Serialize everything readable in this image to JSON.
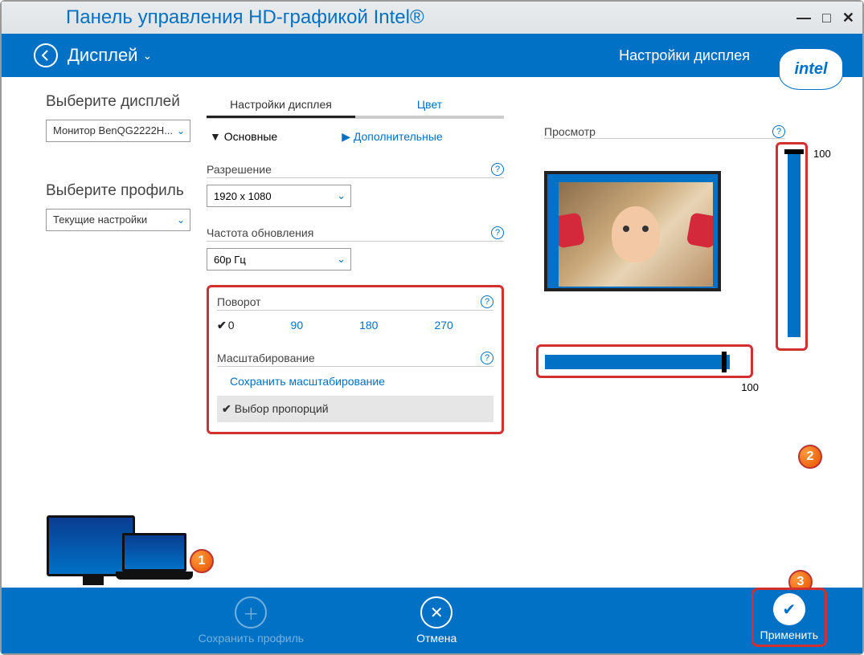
{
  "window": {
    "title": "Панель управления HD-графикой Intel®"
  },
  "header": {
    "page": "Дисплей",
    "section": "Настройки дисплея",
    "logo_text": "intel"
  },
  "left": {
    "select_display_label": "Выберите дисплей",
    "display_value": "Монитор BenQG2222H...",
    "select_profile_label": "Выберите профиль",
    "profile_value": "Текущие настройки"
  },
  "tabs": {
    "settings": "Настройки дисплея",
    "color": "Цвет"
  },
  "subtabs": {
    "basic": "Основные",
    "advanced": "Дополнительные"
  },
  "fields": {
    "resolution_label": "Разрешение",
    "resolution_value": "1920 x 1080",
    "refresh_label": "Частота обновления",
    "refresh_value": "60p Гц",
    "rotation_label": "Поворот",
    "rotation_options": {
      "r0": "0",
      "r90": "90",
      "r180": "180",
      "r270": "270"
    },
    "scaling_label": "Масштабирование",
    "scaling_link": "Сохранить масштабирование",
    "aspect_option": "Выбор пропорций"
  },
  "preview": {
    "label": "Просмотр",
    "vslider_value": "100",
    "hslider_value": "100"
  },
  "badges": {
    "b1": "1",
    "b2": "2",
    "b3": "3"
  },
  "footer": {
    "save_profile": "Сохранить профиль",
    "cancel": "Отмена",
    "apply": "Применить"
  }
}
